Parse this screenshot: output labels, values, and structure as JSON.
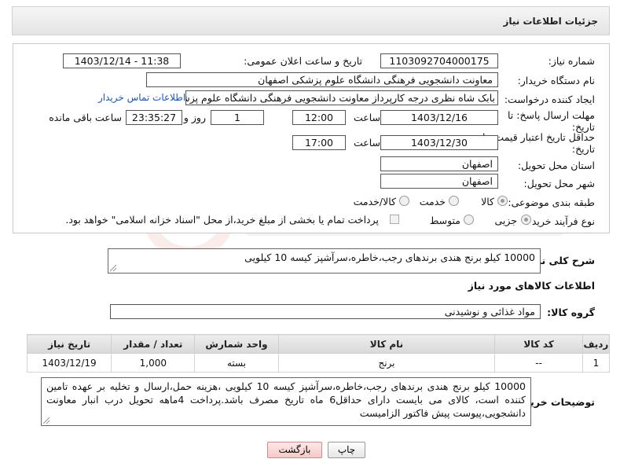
{
  "header": {
    "title": "جزئیات اطلاعات نیاز"
  },
  "form": {
    "need_number_label": "شماره نیاز:",
    "need_number": "1103092704000175",
    "announce_label": "تاریخ و ساعت اعلان عمومی:",
    "announce_value": "1403/12/14 - 11:38",
    "buyer_label": "نام دستگاه خریدار:",
    "buyer_value": "معاونت دانشجویی فرهنگی دانشگاه علوم پزشکی اصفهان",
    "creator_label": "ایجاد کننده درخواست:",
    "creator_value": "بابک شاه نظری درجه کارپرداز معاونت دانشجویی فرهنگی دانشگاه علوم پزشکی",
    "contact_link": "اطلاعات تماس خریدار",
    "deadline_label_1": "مهلت ارسال پاسخ: تا",
    "deadline_label_2": "تاریخ:",
    "deadline_date": "1403/12/16",
    "time_label": "ساعت",
    "deadline_time": "12:00",
    "day_count": "1",
    "day_label": "روز و",
    "remaining_time": "23:35:27",
    "remaining_label": "ساعت باقی مانده",
    "validity_label_1": "حداقل تاریخ اعتبار قیمت: تا",
    "validity_label_2": "تاریخ:",
    "validity_date": "1403/12/30",
    "validity_time_label": "ساعت",
    "validity_time": "17:00",
    "province_label": "استان محل تحویل:",
    "province_value": "اصفهان",
    "city_label": "شهر محل تحویل:",
    "city_value": "اصفهان",
    "category_label": "طبقه بندی موضوعی:",
    "category_options": [
      "کالا",
      "خدمت",
      "کالا/خدمت"
    ],
    "category_selected": "کالا",
    "process_label": "نوع فرآیند خرید :",
    "process_options": [
      "جزیی",
      "متوسط"
    ],
    "process_selected": "جزیی",
    "payment_note": "پرداخت تمام یا بخشی از مبلغ خرید،از محل \"اسناد خزانه اسلامی\" خواهد بود."
  },
  "description": {
    "label": "شرح کلی نیاز:",
    "value": "10000 کیلو برنج هندی برندهای رجب،خاطره،سرآشپز کیسه 10 کیلویی"
  },
  "goods_section": {
    "title": "اطلاعات کالاهای مورد نیاز",
    "group_label": "گروه کالا:",
    "group_value": "مواد غذائی و نوشیدنی"
  },
  "table": {
    "headers": [
      "ردیف",
      "کد کالا",
      "نام کالا",
      "واحد شمارش",
      "تعداد / مقدار",
      "تاریخ نیاز"
    ],
    "rows": [
      {
        "row": "1",
        "code": "--",
        "name": "برنج",
        "unit": "بسته",
        "qty": "1,000",
        "date": "1403/12/19"
      }
    ]
  },
  "buyer_notes": {
    "label": "توضیحات خریدار:",
    "value": "10000 کیلو برنج هندی برندهای رجب،خاطره،سرآشپز کیسه 10 کیلویی ،هزینه حمل،ارسال و تخلیه بر عهده تامین کننده است، کالای می بایست دارای حداقل6 ماه تاریخ مصرف باشد.پرداخت 4ماهه تحویل درب انبار معاونت دانشجویی،پیوست پیش فاکتور الزامیست"
  },
  "buttons": {
    "back": "بازگشت",
    "print": "چاپ"
  },
  "colors": {
    "link": "#1a56b8",
    "back_button": "#f6c9c9"
  }
}
